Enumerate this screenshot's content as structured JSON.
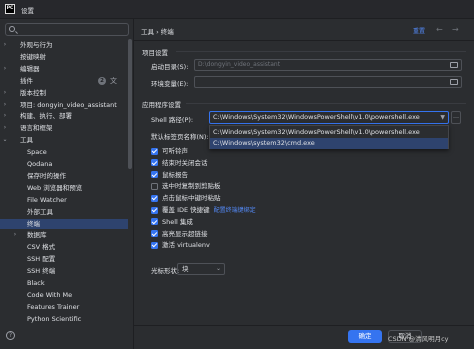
{
  "window": {
    "title": "设置",
    "logo_text": "PC"
  },
  "sidebar": {
    "items": [
      {
        "label": "外观与行为",
        "chevron": "›",
        "indent": 0
      },
      {
        "label": "按键映射",
        "chevron": "",
        "indent": 0
      },
      {
        "label": "编辑器",
        "chevron": "›",
        "indent": 0
      },
      {
        "label": "插件",
        "chevron": "",
        "indent": 0,
        "badge": "2"
      },
      {
        "label": "版本控制",
        "chevron": "›",
        "indent": 0
      },
      {
        "label": "项目: dongyin_video_assistant",
        "chevron": "›",
        "indent": 0
      },
      {
        "label": "构建、执行、部署",
        "chevron": "›",
        "indent": 0
      },
      {
        "label": "语言和框架",
        "chevron": "›",
        "indent": 0
      },
      {
        "label": "工具",
        "chevron": "⌄",
        "indent": 0
      },
      {
        "label": "Space",
        "chevron": "",
        "indent": 1
      },
      {
        "label": "Qodana",
        "chevron": "",
        "indent": 1
      },
      {
        "label": "保存时的操作",
        "chevron": "",
        "indent": 1
      },
      {
        "label": "Web 浏览器和预览",
        "chevron": "",
        "indent": 1
      },
      {
        "label": "File Watcher",
        "chevron": "",
        "indent": 1
      },
      {
        "label": "外部工具",
        "chevron": "",
        "indent": 1
      },
      {
        "label": "终端",
        "chevron": "",
        "indent": 1,
        "selected": true
      },
      {
        "label": "数据库",
        "chevron": "›",
        "indent": 1
      },
      {
        "label": "CSV 格式",
        "chevron": "",
        "indent": 1
      },
      {
        "label": "SSH 配置",
        "chevron": "",
        "indent": 1
      },
      {
        "label": "SSH 终端",
        "chevron": "",
        "indent": 1
      },
      {
        "label": "Black",
        "chevron": "",
        "indent": 1
      },
      {
        "label": "Code With Me",
        "chevron": "",
        "indent": 1
      },
      {
        "label": "Features Trainer",
        "chevron": "",
        "indent": 1
      },
      {
        "label": "Python Scientific",
        "chevron": "",
        "indent": 1
      }
    ]
  },
  "header": {
    "breadcrumb": "工具 › 终端",
    "reset_label": "重置",
    "back_arrow": "←",
    "forward_arrow": "→"
  },
  "project_settings": {
    "title": "项目设置",
    "start_dir_label": "启动目录(S):",
    "start_dir_value": "D:\\dongyin_video_assistant",
    "env_label": "环境变量(E):",
    "env_value": ""
  },
  "app_settings": {
    "title": "应用程序设置",
    "shell_label": "Shell 路径(P):",
    "shell_value": "C:\\Windows\\System32\\WindowsPowerShell\\v1.0\\powershell.exe",
    "tab_name_label": "默认标签页名称(N):",
    "dropdown_options": [
      "C:\\Windows\\System32\\WindowsPowerShell\\v1.0\\powershell.exe",
      "C:\\Windows\\system32\\cmd.exe"
    ],
    "checkboxes": [
      {
        "label": "可听铃声",
        "checked": true
      },
      {
        "label": "结束时关闭会话",
        "checked": true
      },
      {
        "label": "鼠标报告",
        "checked": true
      },
      {
        "label": "选中时复制到剪贴板",
        "checked": false
      },
      {
        "label": "点击鼠标中键时粘贴",
        "checked": true
      },
      {
        "label": "覆盖 IDE 快捷键",
        "checked": true,
        "link": "配置终端键绑定"
      },
      {
        "label": "Shell 集成",
        "checked": true
      },
      {
        "label": "高亮显示超链接",
        "checked": true
      },
      {
        "label": "激活 virtualenv",
        "checked": true
      }
    ],
    "cursor_shape_label": "光标形状:",
    "cursor_shape_value": "块"
  },
  "footer": {
    "ok_label": "确定",
    "cancel_label": "取消",
    "help_label": "?"
  },
  "watermark": "CSDN @清风明月cy",
  "colors": {
    "accent": "#3574f0",
    "selection": "#2e436e",
    "link": "#548af7",
    "background": "#2b2d30"
  }
}
